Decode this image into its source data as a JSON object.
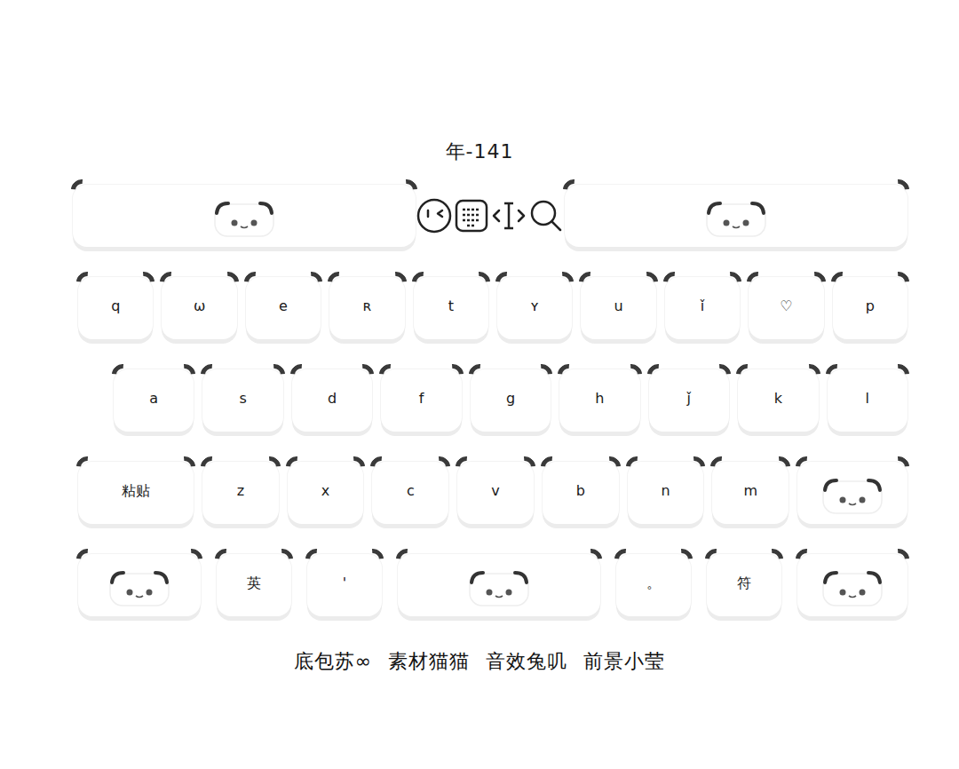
{
  "title": "年-141",
  "toolbar": {
    "items": [
      {
        "kind": "face"
      },
      {
        "kind": "emoji"
      },
      {
        "kind": "keyboard"
      },
      {
        "kind": "cursor"
      },
      {
        "kind": "search"
      },
      {
        "kind": "face"
      }
    ]
  },
  "keyboard": {
    "rows": [
      [
        {
          "kind": "char",
          "label": "q"
        },
        {
          "kind": "char",
          "label": "ω"
        },
        {
          "kind": "char",
          "label": "e"
        },
        {
          "kind": "char",
          "label": "ʀ"
        },
        {
          "kind": "char",
          "label": "t"
        },
        {
          "kind": "char",
          "label": "ʏ"
        },
        {
          "kind": "char",
          "label": "u"
        },
        {
          "kind": "char",
          "label": "ǐ"
        },
        {
          "kind": "char",
          "label": "♡"
        },
        {
          "kind": "char",
          "label": "p"
        }
      ],
      [
        {
          "kind": "char",
          "label": "a"
        },
        {
          "kind": "char",
          "label": "s"
        },
        {
          "kind": "char",
          "label": "d"
        },
        {
          "kind": "char",
          "label": "f"
        },
        {
          "kind": "char",
          "label": "g"
        },
        {
          "kind": "char",
          "label": "h"
        },
        {
          "kind": "char",
          "label": "ǰ"
        },
        {
          "kind": "char",
          "label": "k"
        },
        {
          "kind": "char",
          "label": "l"
        }
      ],
      [
        {
          "kind": "char",
          "label": "粘贴"
        },
        {
          "kind": "char",
          "label": "z"
        },
        {
          "kind": "char",
          "label": "x"
        },
        {
          "kind": "char",
          "label": "c"
        },
        {
          "kind": "char",
          "label": "v"
        },
        {
          "kind": "char",
          "label": "b"
        },
        {
          "kind": "char",
          "label": "n"
        },
        {
          "kind": "char",
          "label": "m"
        },
        {
          "kind": "face",
          "label": ""
        }
      ],
      [
        {
          "kind": "face",
          "label": ""
        },
        {
          "kind": "char",
          "label": "英"
        },
        {
          "kind": "char",
          "label": "'"
        },
        {
          "kind": "face",
          "label": ""
        },
        {
          "kind": "char",
          "label": "。"
        },
        {
          "kind": "char",
          "label": "符"
        },
        {
          "kind": "face",
          "label": ""
        }
      ]
    ]
  },
  "credits": [
    "底包苏∞",
    "素材猫猫",
    "音效兔叽",
    "前景小莹"
  ]
}
